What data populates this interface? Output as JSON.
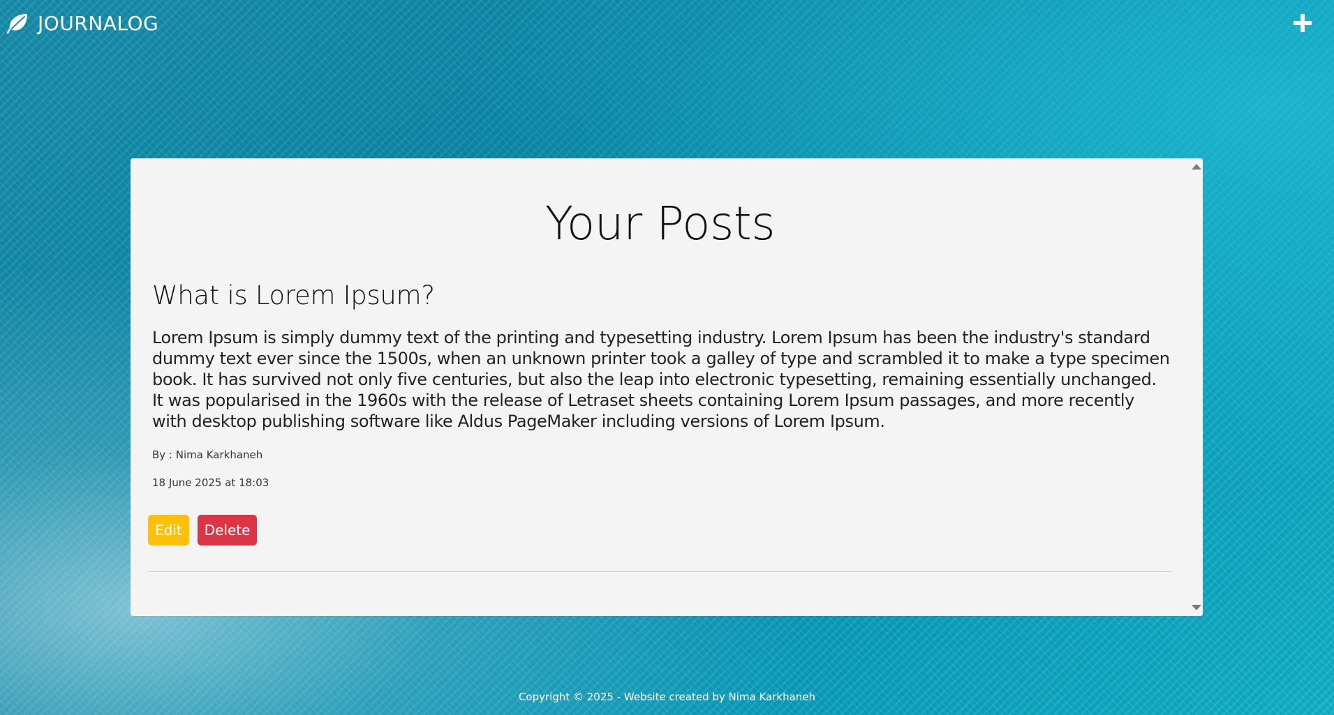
{
  "navbar": {
    "brand_text": "JOURNALOG",
    "brand_icon": "leaf-icon",
    "add_icon": "plus-icon"
  },
  "main": {
    "title": "Your Posts",
    "posts": [
      {
        "title": "What is Lorem Ipsum?",
        "body": "Lorem Ipsum is simply dummy text of the printing and typesetting industry. Lorem Ipsum has been the industry's standard dummy text ever since the 1500s, when an unknown printer took a galley of type and scrambled it to make a type specimen book. It has survived not only five centuries, but also the leap into electronic typesetting, remaining essentially unchanged. It was popularised in the 1960s with the release of Letraset sheets containing Lorem Ipsum passages, and more recently with desktop publishing software like Aldus PageMaker including versions of Lorem Ipsum.",
        "author": "By : Nima Karkhaneh",
        "date": "18 June 2025 at 18:03",
        "edit_label": "Edit",
        "delete_label": "Delete"
      }
    ]
  },
  "footer": {
    "text": "Copyright © 2025 - Website created by Nima Karkhaneh"
  },
  "colors": {
    "edit_button": "#ffc107",
    "delete_button": "#dc3545",
    "card_background": "#f4f4f4",
    "water_accent": "#0b89aa"
  }
}
